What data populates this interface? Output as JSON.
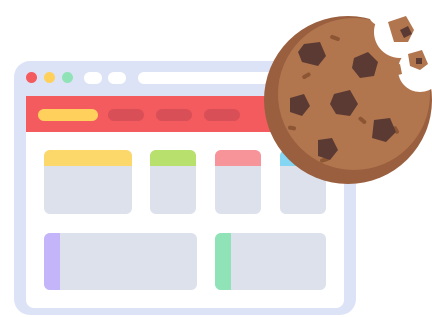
{
  "illustration": {
    "subject": "browser-cookies",
    "colors": {
      "frame": "#dde3f7",
      "navbar": "#f45b5f",
      "navbar_pill_active": "#ffd15c",
      "navbar_pill": "#d94f57",
      "card": "#dde1ec",
      "card_yellow": "#fcd86a",
      "card_green": "#b7e06c",
      "card_pink": "#f6949a",
      "card_blue": "#85d6f3",
      "side_purple": "#c4b5fa",
      "side_green": "#8fe3b7",
      "cookie_dough": "#b2764f",
      "cookie_shadow": "#9a5f3e",
      "chocolate_chip": "#5b3a33"
    },
    "window_controls": [
      {
        "name": "close",
        "color": "#f45b5f"
      },
      {
        "name": "minimize",
        "color": "#ffd15c"
      },
      {
        "name": "maximize",
        "color": "#8fe3b7"
      }
    ],
    "icons": [
      "cookie-icon"
    ]
  }
}
